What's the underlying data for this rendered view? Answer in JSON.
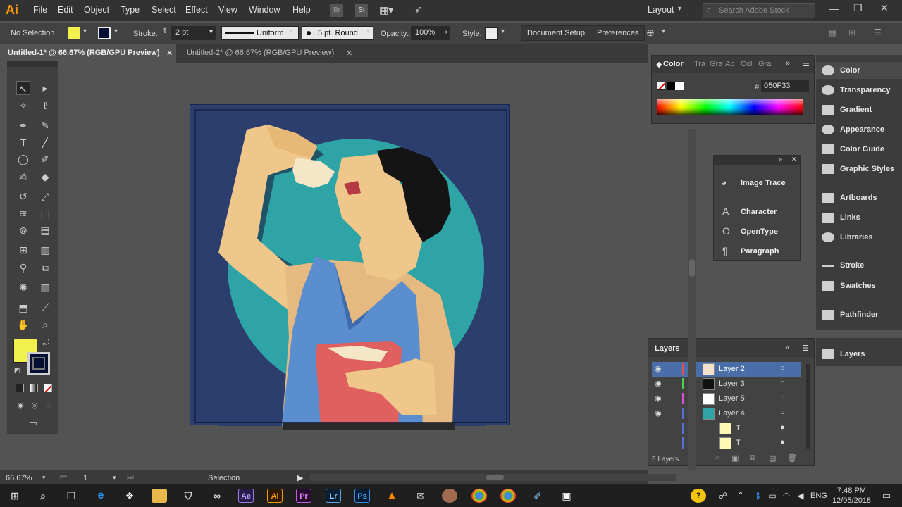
{
  "app": {
    "logo": "Ai",
    "workspace": "Layout",
    "search_placeholder": "Search Adobe Stock"
  },
  "menu": [
    "File",
    "Edit",
    "Object",
    "Type",
    "Select",
    "Effect",
    "View",
    "Window",
    "Help"
  ],
  "menu_icons": [
    "Br",
    "St"
  ],
  "control": {
    "selection": "No Selection",
    "stroke_label": "Stroke:",
    "stroke_weight": "2 pt",
    "profile": "Uniform",
    "brush": "5 pt. Round",
    "opacity_label": "Opacity:",
    "opacity": "100%",
    "style_label": "Style:",
    "document_setup": "Document Setup",
    "preferences": "Preferences",
    "fill_color": "#f1f04c",
    "stroke_color": "#050f33"
  },
  "tabs": [
    {
      "label": "Untitled-1* @ 66.67% (RGB/GPU Preview)",
      "active": true
    },
    {
      "label": "Untitled-2* @ 66.67% (RGB/GPU Preview)",
      "active": false
    }
  ],
  "color_panel": {
    "tabs": [
      "Color",
      "Tra",
      "Gra",
      "Ap",
      "Col",
      "Gra"
    ],
    "hex_label": "#",
    "hex": "050F33"
  },
  "float_panel": {
    "items": [
      "Image Trace",
      "Character",
      "OpenType",
      "Paragraph"
    ]
  },
  "dock": {
    "items": [
      "Color",
      "Transparency",
      "Gradient",
      "Appearance",
      "Color Guide",
      "Graphic Styles",
      "Artboards",
      "Links",
      "Libraries",
      "Stroke",
      "Swatches",
      "Pathfinder"
    ],
    "layers": "Layers"
  },
  "layers_panel": {
    "title": "Layers",
    "rows": [
      {
        "name": "Layer 2",
        "color": "#e25151",
        "selected": true,
        "expanded": false
      },
      {
        "name": "Layer 3",
        "color": "#4fd04f",
        "selected": false,
        "expanded": false
      },
      {
        "name": "Layer 5",
        "color": "#d94fd9",
        "selected": false,
        "expanded": false
      },
      {
        "name": "Layer 4",
        "color": "#5a6fd9",
        "selected": false,
        "expanded": true
      }
    ],
    "sublayers": [
      "T",
      "T"
    ],
    "count": "5 Layers"
  },
  "status": {
    "zoom": "66.67%",
    "artboard": "1",
    "tool": "Selection"
  },
  "taskbar": {
    "lang": "ENG",
    "time": "7:48 PM",
    "date": "12/05/2018"
  }
}
